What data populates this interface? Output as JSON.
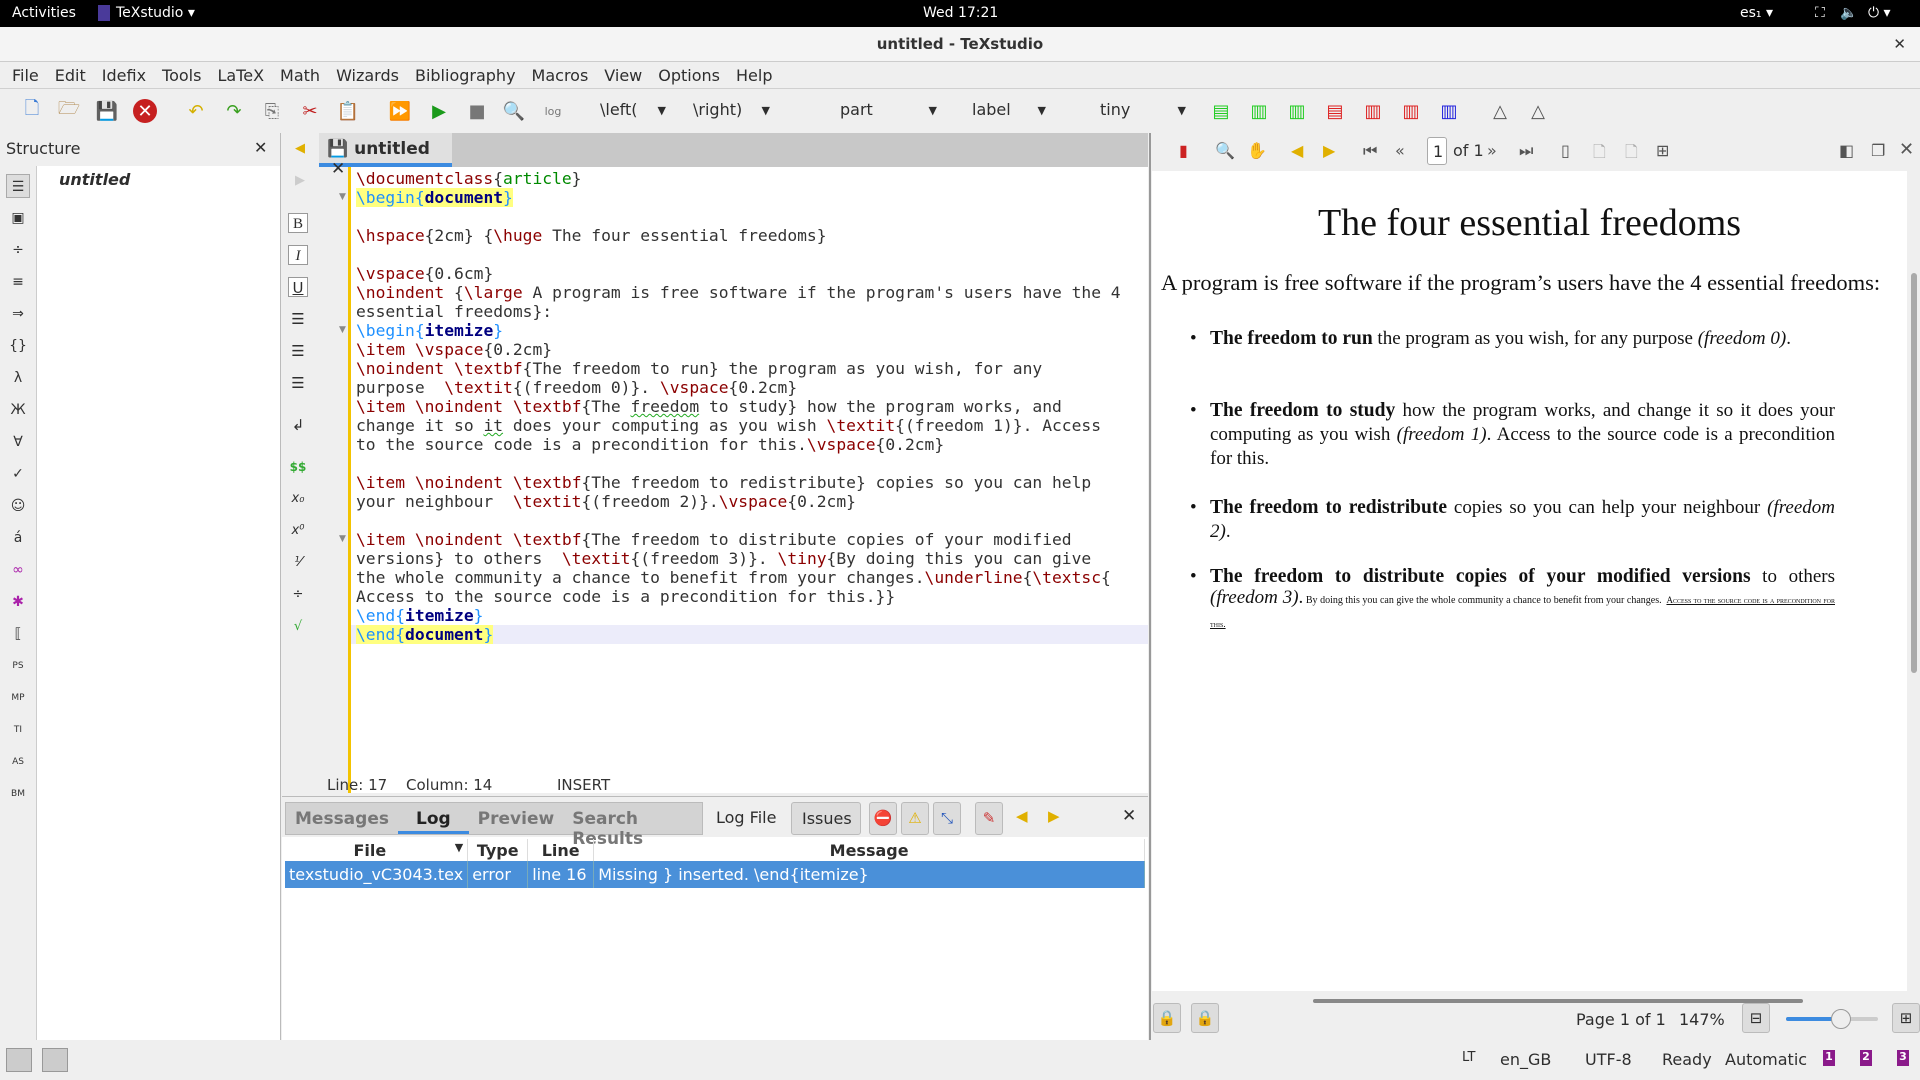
{
  "topbar": {
    "activities": "Activities",
    "app": "TeXstudio ▾",
    "clock": "Wed 17:21",
    "input_lang": "es₁ ▾",
    "power": "⏻ ▾"
  },
  "window": {
    "title": "untitled - TeXstudio",
    "close": "✕"
  },
  "menu": [
    "File",
    "Edit",
    "Idefix",
    "Tools",
    "LaTeX",
    "Math",
    "Wizards",
    "Bibliography",
    "Macros",
    "View",
    "Options",
    "Help"
  ],
  "toolbar": {
    "dropdowns": [
      "\\left(",
      "\\right)",
      "part",
      "label",
      "tiny"
    ]
  },
  "structure": {
    "title": "Structure",
    "close": "✕",
    "root": "untitled"
  },
  "editor": {
    "tab": "untitled",
    "tab_close": "✕",
    "lines": [
      [
        [
          "\\documentclass",
          "cmd"
        ],
        [
          "{",
          ""
        ],
        [
          "article",
          "arg"
        ],
        [
          "}",
          ""
        ]
      ],
      [
        [
          "\\begin{",
          "beg"
        ],
        [
          "document",
          "env"
        ],
        [
          "}",
          "beg"
        ]
      ],
      [],
      [
        [
          "\\hspace",
          "cmd"
        ],
        [
          "{2cm} {",
          ""
        ],
        [
          "\\huge",
          "cmd"
        ],
        [
          " The four essential freedoms}",
          ""
        ]
      ],
      [],
      [
        [
          "\\vspace",
          "cmd"
        ],
        [
          "{0.6cm}",
          ""
        ]
      ],
      [
        [
          "\\noindent",
          "cmd"
        ],
        [
          " {",
          ""
        ],
        [
          "\\large",
          "cmd"
        ],
        [
          " A program is free software if the program's users have the 4",
          ""
        ]
      ],
      [
        [
          "essential freedoms}:",
          ""
        ]
      ],
      [
        [
          "\\begin{",
          "beg2"
        ],
        [
          "itemize",
          "env2"
        ],
        [
          "}",
          "beg2"
        ]
      ],
      [
        [
          "\\item",
          "cmd"
        ],
        [
          " ",
          ""
        ],
        [
          "\\vspace",
          "cmd"
        ],
        [
          "{0.2cm}",
          ""
        ]
      ],
      [
        [
          "\\noindent",
          "cmd"
        ],
        [
          " ",
          ""
        ],
        [
          "\\textbf",
          "cmd"
        ],
        [
          "{The freedom to run} the program as you wish, for any",
          ""
        ]
      ],
      [
        [
          "purpose  ",
          ""
        ],
        [
          "\\textit",
          "cmd"
        ],
        [
          "{(freedom 0)}. ",
          ""
        ],
        [
          "\\vspace",
          "cmd"
        ],
        [
          "{0.2cm}",
          ""
        ]
      ],
      [
        [
          "\\item",
          "cmd"
        ],
        [
          " ",
          ""
        ],
        [
          "\\noindent",
          "cmd"
        ],
        [
          " ",
          ""
        ],
        [
          "\\textbf",
          "cmd"
        ],
        [
          "{The ",
          ""
        ],
        [
          "freedom",
          "spell"
        ],
        [
          " to study} how the program works, and",
          ""
        ]
      ],
      [
        [
          "change it so ",
          ""
        ],
        [
          "it",
          "spell"
        ],
        [
          " does your computing as you wish ",
          ""
        ],
        [
          "\\textit",
          "cmd"
        ],
        [
          "{(freedom 1)}. Access",
          ""
        ]
      ],
      [
        [
          "to the source code is a precondition for this.",
          ""
        ],
        [
          "\\vspace",
          "cmd"
        ],
        [
          "{0.2cm}",
          ""
        ]
      ],
      [],
      [
        [
          "\\item",
          "cmd"
        ],
        [
          " ",
          ""
        ],
        [
          "\\noindent",
          "cmd"
        ],
        [
          " ",
          ""
        ],
        [
          "\\textbf",
          "cmd"
        ],
        [
          "{The freedom to redistribute} copies so you can help",
          ""
        ]
      ],
      [
        [
          "your neighbour  ",
          ""
        ],
        [
          "\\textit",
          "cmd"
        ],
        [
          "{(freedom 2)}.",
          ""
        ],
        [
          "\\vspace",
          "cmd"
        ],
        [
          "{0.2cm}",
          ""
        ]
      ],
      [],
      [
        [
          "\\item",
          "cmd"
        ],
        [
          " ",
          ""
        ],
        [
          "\\noindent",
          "cmd"
        ],
        [
          " ",
          ""
        ],
        [
          "\\textbf",
          "cmd"
        ],
        [
          "{The freedom to distribute copies of your modified",
          ""
        ]
      ],
      [
        [
          "versions} to others  ",
          ""
        ],
        [
          "\\textit",
          "cmd"
        ],
        [
          "{(freedom 3)}. ",
          ""
        ],
        [
          "\\tiny",
          "cmd"
        ],
        [
          "{By doing this you can give",
          ""
        ]
      ],
      [
        [
          "the whole community a chance to benefit from your changes.",
          ""
        ],
        [
          "\\underline",
          "cmd"
        ],
        [
          "{",
          ""
        ],
        [
          "\\textsc",
          "cmd"
        ],
        [
          "{",
          ""
        ]
      ],
      [
        [
          "Access to the source code is a precondition for this.}}",
          ""
        ]
      ],
      [
        [
          "\\end{",
          "beg2"
        ],
        [
          "itemize",
          "env2"
        ],
        [
          "}",
          "beg2"
        ]
      ],
      [
        [
          "\\end{",
          "beg"
        ],
        [
          "document",
          "env"
        ],
        [
          "}",
          "beg"
        ]
      ]
    ],
    "status": {
      "line": "Line: 17",
      "column": "Column: 14",
      "mode": "INSERT"
    }
  },
  "log": {
    "tabs": [
      "Messages",
      "Log",
      "Preview",
      "Search Results"
    ],
    "active_tab": "Log",
    "log_file": "Log File",
    "issues": "Issues",
    "close": "✕",
    "columns": [
      "File",
      "Type",
      "Line",
      "Message"
    ],
    "rows": [
      [
        "texstudio_vC3043.tex",
        "error",
        "line 16",
        "Missing } inserted. \\end{itemize}"
      ]
    ]
  },
  "pdf": {
    "page_input": "1",
    "of_pages": "of 1",
    "title": "The four essential freedoms",
    "intro": "A program is free software if the program’s users have the 4 essential freedoms:",
    "items": [
      {
        "bold": "The freedom to run",
        "text": " the program as you wish, for any purpose ",
        "italic": "(freedom 0)",
        "tail": "."
      },
      {
        "bold": "The freedom to study",
        "text": " how the program works, and change it so it does your computing as you wish ",
        "italic": "(freedom 1)",
        "tail": ". Access to the source code is a precondition for this."
      },
      {
        "bold": "The freedom to redistribute",
        "text": " copies so you can help your neighbour ",
        "italic": "(freedom 2)",
        "tail": "."
      },
      {
        "bold": "The freedom to distribute copies of your modified versions",
        "text": " to others ",
        "italic": "(freedom 3)",
        "tail": ".",
        "tiny": " By doing this you can give the whole community a chance to benefit from your changes.",
        "smallcaps": "Access to the source code is a precondition for this."
      }
    ],
    "page_label": "Page 1 of 1",
    "zoom": "147%",
    "zoom_slider_fraction": 0.6
  },
  "statusbar": {
    "lt": "LT",
    "language": "en_GB",
    "encoding": "UTF-8",
    "state": "Ready",
    "mode": "Automatic",
    "bookmarks": [
      "1",
      "2",
      "3"
    ]
  }
}
